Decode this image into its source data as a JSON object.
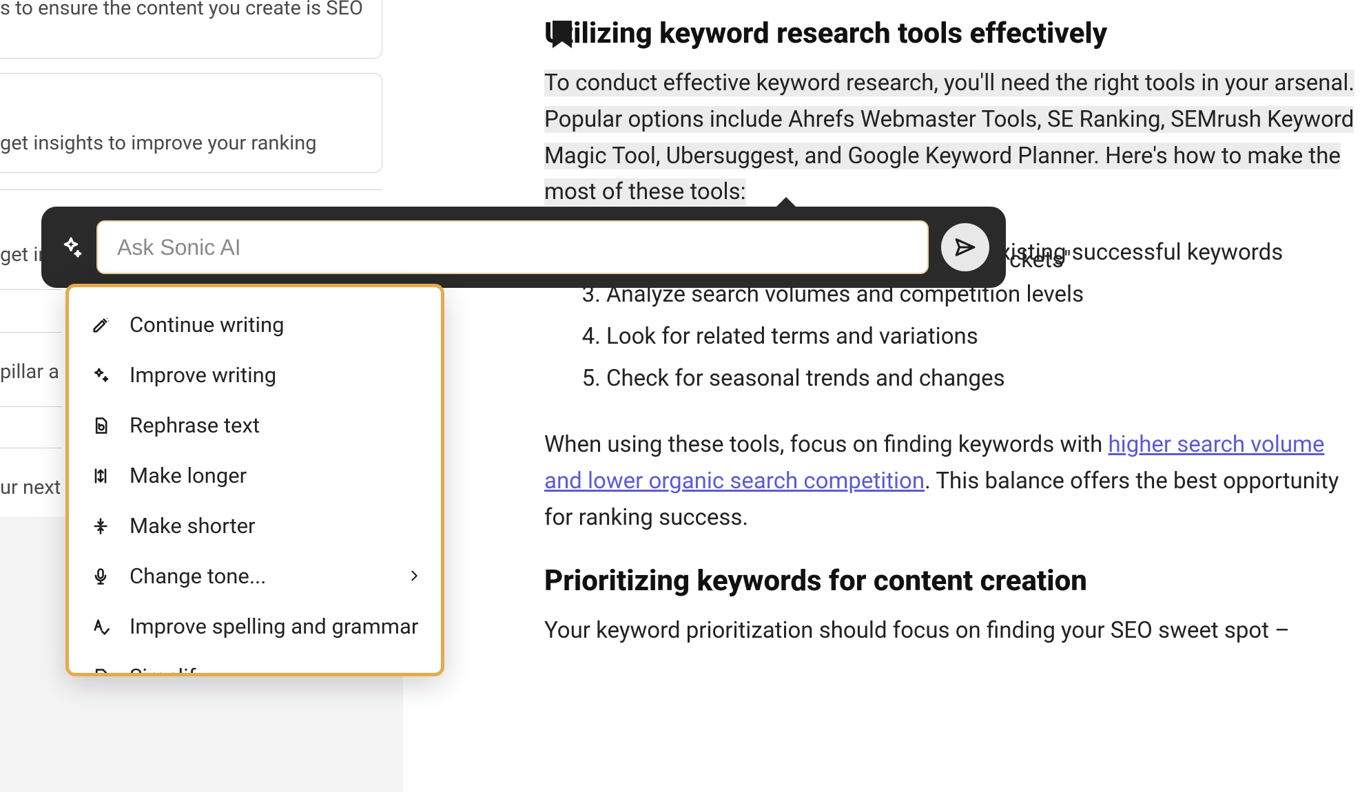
{
  "sidebar": {
    "frag1": "s to ensure the content you create is SEO",
    "frag2": "get insights to improve your ranking",
    "frag3": "get in",
    "frag4": "pillar a",
    "frag5": "ur next"
  },
  "ai": {
    "placeholder": "Ask Sonic AI",
    "menu": {
      "continue": "Continue writing",
      "improve": "Improve writing",
      "rephrase": "Rephrase text",
      "longer": "Make longer",
      "shorter": "Make shorter",
      "tone": "Change tone...",
      "grammar": "Improve spelling and grammar",
      "simplify": "Simplify"
    }
  },
  "article": {
    "h1": "Utilizing keyword research tools effectively",
    "p1_highlight": "To conduct effective keyword research, you'll need the right tools in your arsenal. Popular options include Ahrefs Webmaster Tools, SE Ranking, SEMrush Keyword Magic Tool, Ubersuggest, and Google Keyword Planner. Here's how to make the most of these tools:",
    "peek": "ckets\"",
    "list": {
      "i2": "Use website analytics data to identify existing successful keywords",
      "i3": "Analyze search volumes and competition levels",
      "i4": "Look for related terms and variations",
      "i5": "Check for seasonal trends and changes"
    },
    "p2_a": "When using these tools, focus on finding keywords with ",
    "p2_link": "higher search volume and lower organic search competition",
    "p2_b": ". This balance offers the best opportunity for ranking success.",
    "h2": "Prioritizing keywords for content creation",
    "p3": "Your keyword prioritization should focus on finding your SEO sweet spot –"
  }
}
